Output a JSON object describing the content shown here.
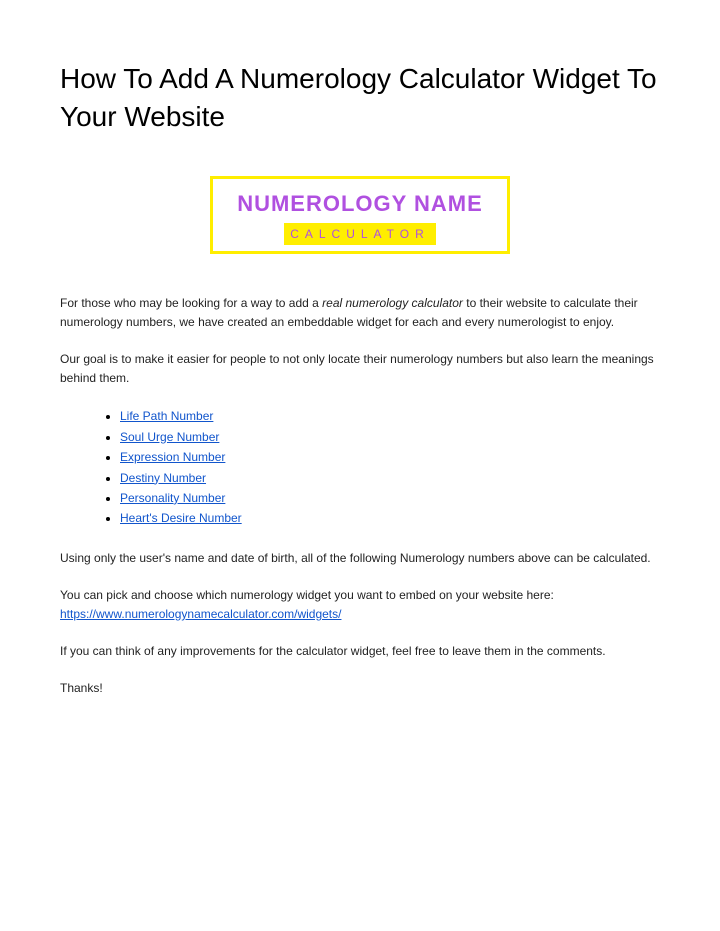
{
  "title": "How To Add A Numerology Calculator Widget To Your Website",
  "logo": {
    "main": "NUMEROLOGY NAME",
    "sub": "CALCULATOR"
  },
  "para1_a": "For those who may be looking for a way to add a ",
  "para1_italic": "real numerology calculator",
  "para1_b": " to their website to calculate their numerology numbers, we have created an embeddable widget for each and every numerologist to enjoy.",
  "para2": "Our goal is to make it easier for people to not only locate their numerology numbers but also learn the meanings behind them.",
  "links": {
    "0": "Life Path Number",
    "1": "Soul Urge Number",
    "2": "Expression Number",
    "3": "Destiny Number",
    "4": "Personality Number",
    "5": "Heart's Desire Number"
  },
  "para3": "Using only the user's name and date of birth, all of the following Numerology numbers above can be calculated.",
  "para4": "You can pick and choose which numerology widget you want to embed on your website here:",
  "url": "https://www.numerologynamecalculator.com/widgets/",
  "para5": "If you can think of any improvements for the calculator widget, feel free to leave them in the comments.",
  "para6": "Thanks!"
}
